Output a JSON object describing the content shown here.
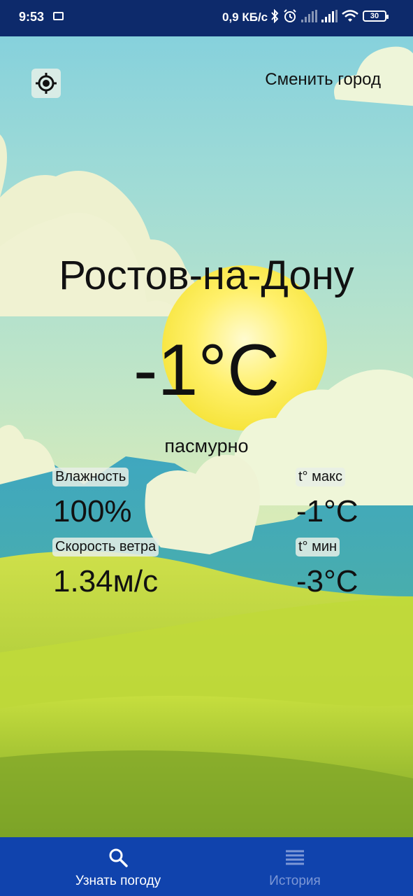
{
  "status_bar": {
    "time": "9:53",
    "net_speed": "0,9 КБ/с",
    "battery": "30"
  },
  "header": {
    "change_city_label": "Сменить город"
  },
  "weather": {
    "city": "Ростов-на-Дону",
    "temperature": "-1°C",
    "description": "пасмурно",
    "humidity_label": "Влажность",
    "humidity_value": "100%",
    "tmax_label": "t° макс",
    "tmax_value": "-1°C",
    "wind_label": "Скорость ветра",
    "wind_value": "1.34м/с",
    "tmin_label": "t° мин",
    "tmin_value": "-3°C"
  },
  "bottom_nav": {
    "items": [
      {
        "label": "Узнать погоду",
        "icon": "search-icon",
        "active": true
      },
      {
        "label": "История",
        "icon": "list-icon",
        "active": false
      }
    ]
  },
  "colors": {
    "status_bar": "#0d2a6b",
    "nav_bar": "#1043ad",
    "nav_active": "#ffffff",
    "nav_inactive": "#7c97d6"
  }
}
